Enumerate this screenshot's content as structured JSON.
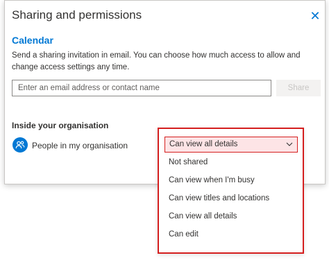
{
  "dialog": {
    "title": "Sharing and permissions",
    "close_glyph": "✕",
    "section_title": "Calendar",
    "description": "Send a sharing invitation in email. You can choose how much access to allow and change access settings any time.",
    "email_placeholder": "Enter an email address or contact name",
    "share_label": "Share"
  },
  "org": {
    "heading": "Inside your organisation",
    "row_label": "People in my organisation",
    "icon": "people-icon"
  },
  "permission_dropdown": {
    "selected": "Can view all details",
    "options": [
      "Not shared",
      "Can view when I'm busy",
      "Can view titles and locations",
      "Can view all details",
      "Can edit"
    ]
  },
  "colors": {
    "accent": "#0078d4",
    "highlight_border": "#d51f1f",
    "selected_bg": "#fde4e6"
  }
}
